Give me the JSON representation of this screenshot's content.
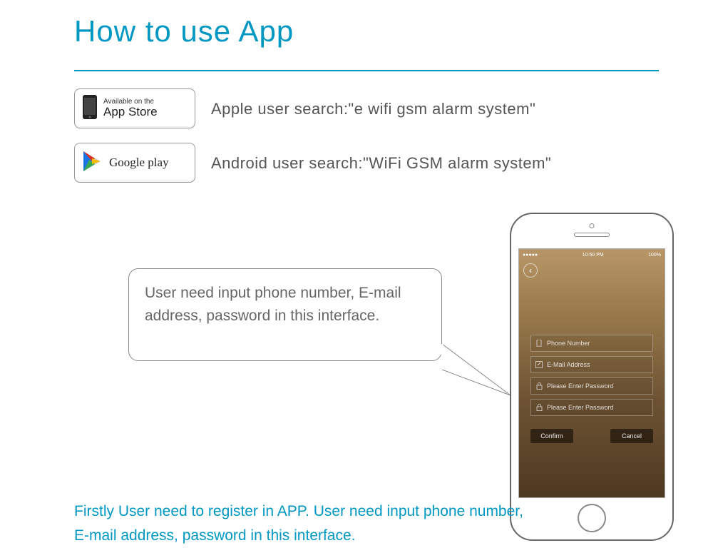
{
  "title": "How to use App",
  "appstore": {
    "line1": "Available on the",
    "line2": "App Store",
    "instruction": "Apple user search:\"e wifi gsm alarm system\""
  },
  "gplay": {
    "line": "Google play",
    "instruction": "Android user search:\"WiFi GSM alarm system\""
  },
  "bubble": "User need input phone number, E-mail address, password in this interface.",
  "phone": {
    "status_time": "10:50 PM",
    "status_battery": "100%",
    "fields": {
      "phone": "Phone Number",
      "email": "E-Mail Address",
      "pass1": "Please Enter Password",
      "pass2": "Please Enter Password"
    },
    "confirm": "Confirm",
    "cancel": "Cancel"
  },
  "footer": "Firstly User need to register in APP. User need input phone number, E-mail address, password in this interface."
}
